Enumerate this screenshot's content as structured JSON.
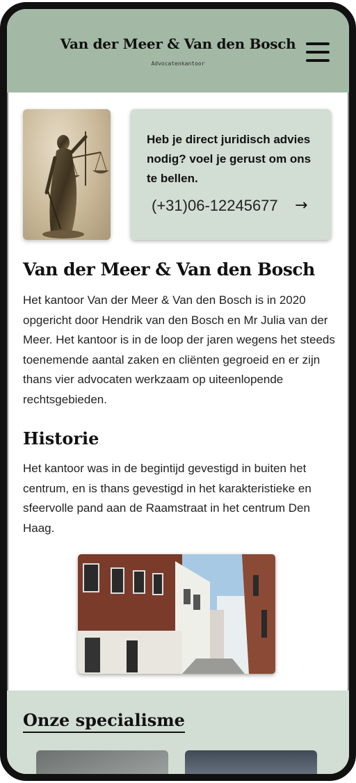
{
  "header": {
    "title": "Van der Meer & Van den Bosch",
    "subtitle": "Advocatenkantoor",
    "menu_icon": "hamburger-menu-icon"
  },
  "callout": {
    "text": "Heb je direct juridisch advies nodig? voel je gerust om ons te bellen.",
    "phone": "(+31)06-12245677",
    "arrow": "→"
  },
  "about": {
    "heading": "Van der Meer & Van den Bosch",
    "body": "Het kantoor Van der Meer & Van den Bosch is in 2020 opgericht door Hendrik van den Bosch en Mr Julia van der Meer. Het kantoor is in de loop der jaren wegens het steeds toenemende aantal zaken en cliënten gegroeid en er zijn thans vier advocaten werkzaam op uiteenlopende rechtsgebieden."
  },
  "history": {
    "heading": "Historie",
    "body": "Het kantoor was in de begintijd gevestigd in buiten het centrum, en is thans gevestigd in het karakteristieke en sfeervolle pand aan de Raamstraat in het centrum Den Haag."
  },
  "specialisms": {
    "heading": "Onze specialisme"
  },
  "colors": {
    "header_bg": "#a3b9a6",
    "panel_bg": "#d2ddd3",
    "text": "#111111"
  }
}
